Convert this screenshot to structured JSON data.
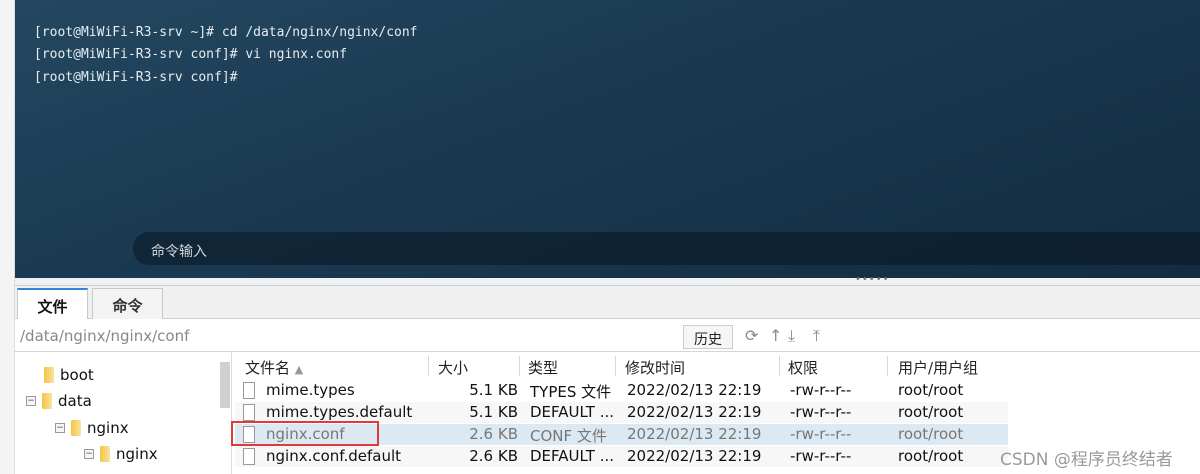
{
  "terminal": {
    "lines": [
      "[root@MiWiFi-R3-srv ~]# cd /data/nginx/nginx/conf",
      "[root@MiWiFi-R3-srv conf]# vi nginx.conf",
      "[root@MiWiFi-R3-srv conf]#"
    ],
    "command_input_placeholder": "命令输入"
  },
  "tabs": [
    {
      "label": "文件",
      "active": true
    },
    {
      "label": "命令",
      "active": false
    }
  ],
  "path": "/data/nginx/nginx/conf",
  "history_button": "历史",
  "toolbar_icons": [
    "refresh-icon",
    "up-dir-icon",
    "download-icon",
    "upload-icon"
  ],
  "tree": [
    {
      "label": "boot"
    },
    {
      "label": "data"
    },
    {
      "label": "nginx"
    },
    {
      "label": "nginx"
    }
  ],
  "columns": {
    "name": "文件名",
    "size": "大小",
    "type": "类型",
    "mtime": "修改时间",
    "perm": "权限",
    "owner": "用户/用户组"
  },
  "files": [
    {
      "name": "mime.types",
      "size": "5.1 KB",
      "type": "TYPES 文件",
      "mtime": "2022/02/13 22:19",
      "perm": "-rw-r--r--",
      "owner": "root/root"
    },
    {
      "name": "mime.types.default",
      "size": "5.1 KB",
      "type": "DEFAULT ...",
      "mtime": "2022/02/13 22:19",
      "perm": "-rw-r--r--",
      "owner": "root/root"
    },
    {
      "name": "nginx.conf",
      "size": "2.6 KB",
      "type": "CONF 文件",
      "mtime": "2022/02/13 22:19",
      "perm": "-rw-r--r--",
      "owner": "root/root",
      "selected": true
    },
    {
      "name": "nginx.conf.default",
      "size": "2.6 KB",
      "type": "DEFAULT ...",
      "mtime": "2022/02/13 22:19",
      "perm": "-rw-r--r--",
      "owner": "root/root"
    }
  ],
  "watermark": "CSDN @程序员终结者"
}
